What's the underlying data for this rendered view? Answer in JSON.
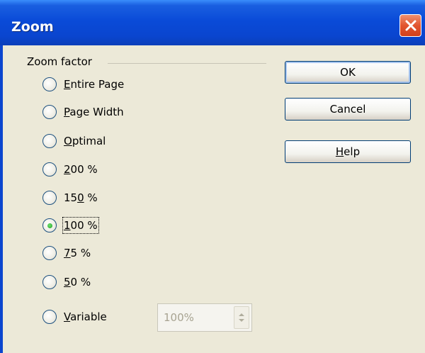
{
  "window": {
    "title": "Zoom"
  },
  "group": {
    "label": "Zoom factor"
  },
  "options": [
    {
      "pre": "",
      "mnemonic": "E",
      "post": "ntire Page",
      "checked": false
    },
    {
      "pre": "",
      "mnemonic": "P",
      "post": "age Width",
      "checked": false
    },
    {
      "pre": "",
      "mnemonic": "O",
      "post": "ptimal",
      "checked": false
    },
    {
      "pre": "",
      "mnemonic": "2",
      "post": "00 %",
      "checked": false
    },
    {
      "pre": "15",
      "mnemonic": "0",
      "post": " %",
      "checked": false
    },
    {
      "pre": "",
      "mnemonic": "1",
      "post": "00 %",
      "checked": true
    },
    {
      "pre": "",
      "mnemonic": "7",
      "post": "5 %",
      "checked": false
    },
    {
      "pre": "",
      "mnemonic": "5",
      "post": "0 %",
      "checked": false
    },
    {
      "pre": "",
      "mnemonic": "V",
      "post": "ariable",
      "checked": false
    }
  ],
  "variable_field": {
    "value": "100%"
  },
  "buttons": {
    "ok": "OK",
    "cancel": "Cancel",
    "help_mnemonic": "H",
    "help_rest": "elp"
  }
}
